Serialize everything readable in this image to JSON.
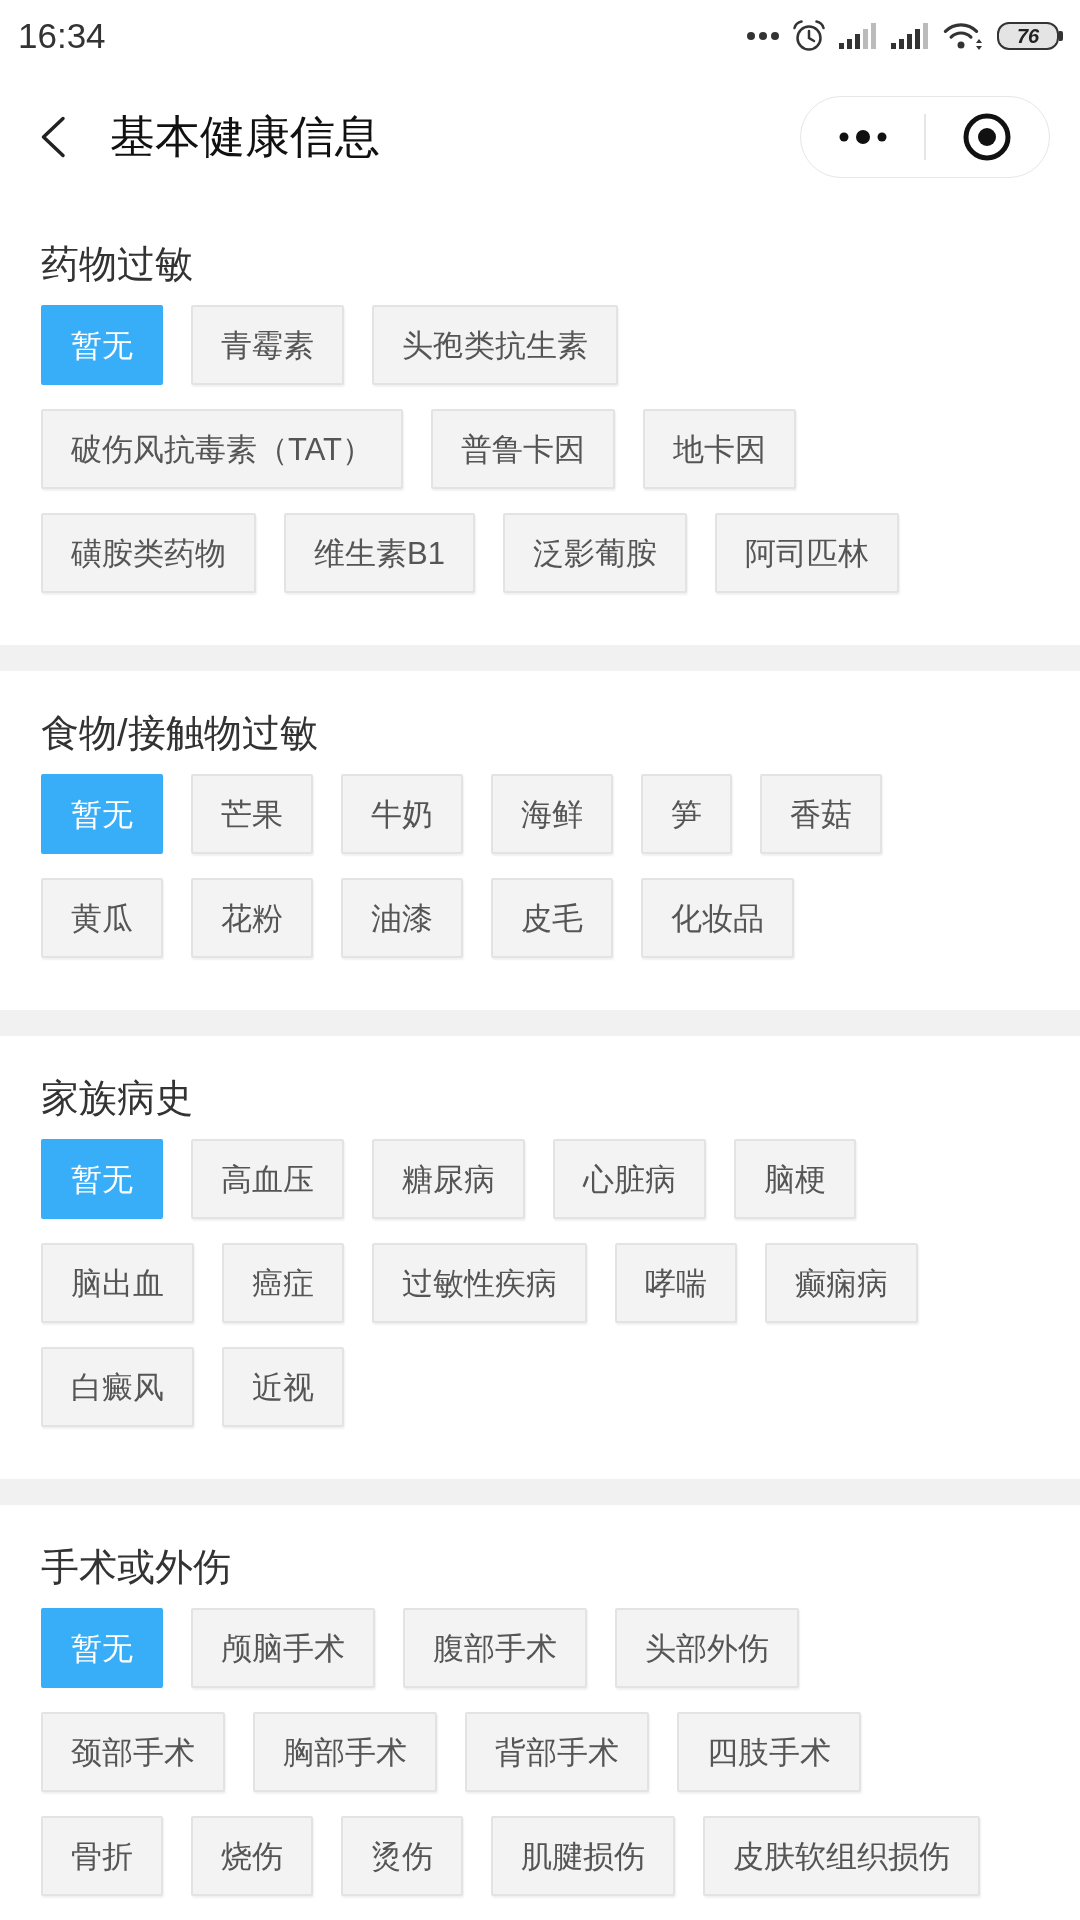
{
  "status_bar": {
    "time": "16:34",
    "battery": "76"
  },
  "nav_bar": {
    "title": "基本健康信息"
  },
  "sections": [
    {
      "title": "药物过敏",
      "options": [
        {
          "label": "暂无",
          "selected": true
        },
        {
          "label": "青霉素",
          "selected": false
        },
        {
          "label": "头孢类抗生素",
          "selected": false
        },
        {
          "label": "破伤风抗毒素（TAT）",
          "selected": false
        },
        {
          "label": "普鲁卡因",
          "selected": false
        },
        {
          "label": "地卡因",
          "selected": false
        },
        {
          "label": "磺胺类药物",
          "selected": false
        },
        {
          "label": "维生素B1",
          "selected": false
        },
        {
          "label": "泛影葡胺",
          "selected": false
        },
        {
          "label": "阿司匹林",
          "selected": false
        }
      ]
    },
    {
      "title": "食物/接触物过敏",
      "options": [
        {
          "label": "暂无",
          "selected": true
        },
        {
          "label": "芒果",
          "selected": false
        },
        {
          "label": "牛奶",
          "selected": false
        },
        {
          "label": "海鲜",
          "selected": false
        },
        {
          "label": "笋",
          "selected": false
        },
        {
          "label": "香菇",
          "selected": false
        },
        {
          "label": "黄瓜",
          "selected": false
        },
        {
          "label": "花粉",
          "selected": false
        },
        {
          "label": "油漆",
          "selected": false
        },
        {
          "label": "皮毛",
          "selected": false
        },
        {
          "label": "化妆品",
          "selected": false
        }
      ]
    },
    {
      "title": "家族病史",
      "options": [
        {
          "label": "暂无",
          "selected": true
        },
        {
          "label": "高血压",
          "selected": false
        },
        {
          "label": "糖尿病",
          "selected": false
        },
        {
          "label": "心脏病",
          "selected": false
        },
        {
          "label": "脑梗",
          "selected": false
        },
        {
          "label": "脑出血",
          "selected": false
        },
        {
          "label": "癌症",
          "selected": false
        },
        {
          "label": "过敏性疾病",
          "selected": false
        },
        {
          "label": "哮喘",
          "selected": false
        },
        {
          "label": "癫痫病",
          "selected": false
        },
        {
          "label": "白癜风",
          "selected": false
        },
        {
          "label": "近视",
          "selected": false
        }
      ]
    },
    {
      "title": "手术或外伤",
      "options": [
        {
          "label": "暂无",
          "selected": true
        },
        {
          "label": "颅脑手术",
          "selected": false
        },
        {
          "label": "腹部手术",
          "selected": false
        },
        {
          "label": "头部外伤",
          "selected": false
        },
        {
          "label": "颈部手术",
          "selected": false
        },
        {
          "label": "胸部手术",
          "selected": false
        },
        {
          "label": "背部手术",
          "selected": false
        },
        {
          "label": "四肢手术",
          "selected": false
        },
        {
          "label": "骨折",
          "selected": false
        },
        {
          "label": "烧伤",
          "selected": false
        },
        {
          "label": "烫伤",
          "selected": false
        },
        {
          "label": "肌腱损伤",
          "selected": false
        },
        {
          "label": "皮肤软组织损伤",
          "selected": false
        }
      ]
    }
  ]
}
